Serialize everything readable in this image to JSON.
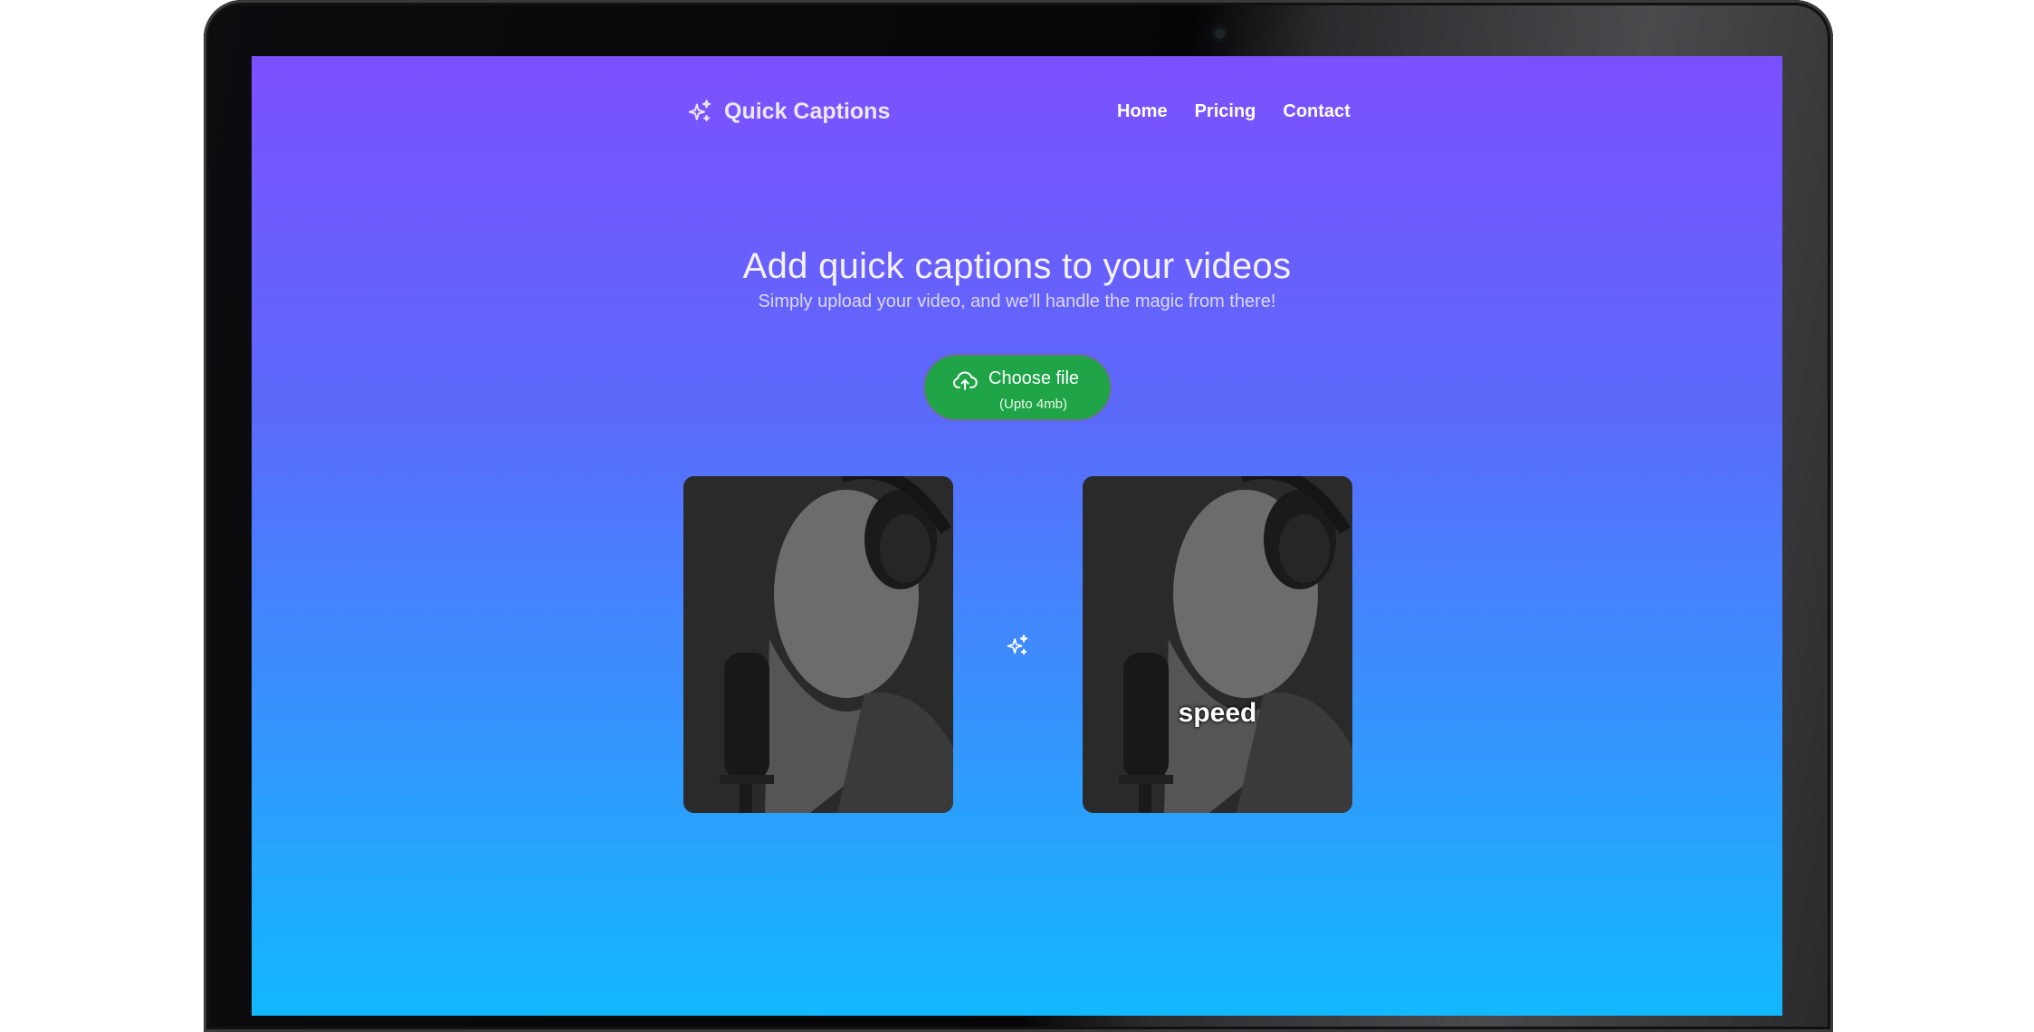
{
  "brand": {
    "name": "Quick Captions",
    "icon": "sparkles-icon"
  },
  "nav": {
    "items": [
      {
        "label": "Home"
      },
      {
        "label": "Pricing"
      },
      {
        "label": "Contact"
      }
    ]
  },
  "hero": {
    "title": "Add quick captions to your videos",
    "subtitle": "Simply upload your video, and we'll handle the magic from there!"
  },
  "upload": {
    "label": "Choose file",
    "note": "(Upto 4mb)",
    "icon": "cloud-upload-icon"
  },
  "preview": {
    "original_icon": "video-thumbnail",
    "transform_icon": "sparkles-icon",
    "caption": "speed"
  },
  "colors": {
    "gradient_top": "#7c50fe",
    "gradient_bottom": "#12b8ff",
    "button_green": "#1fa548"
  }
}
